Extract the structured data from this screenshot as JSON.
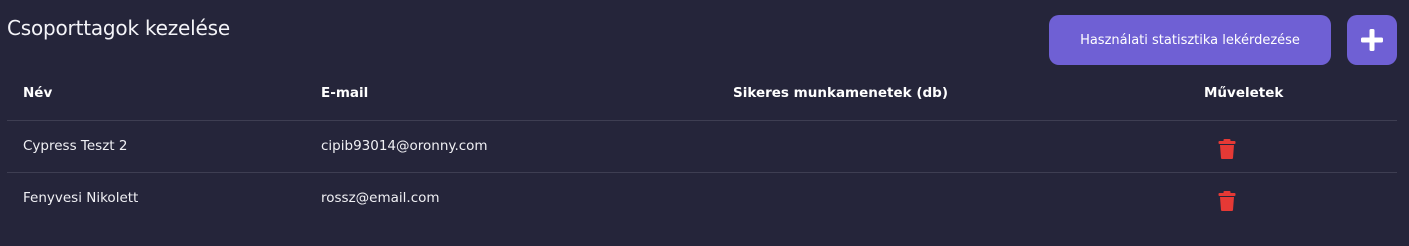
{
  "page": {
    "title": "Csoporttagok kezelése"
  },
  "toolbar": {
    "stats_button_label": "Használati statisztika lekérdezése",
    "add_button_icon": "plus-icon"
  },
  "table": {
    "headers": {
      "name": "Név",
      "email": "E-mail",
      "sessions": "Sikeres munkamenetek (db)",
      "actions": "Műveletek"
    },
    "rows": [
      {
        "name": "Cypress Teszt 2",
        "email": "cipib93014@oronny.com",
        "sessions": "",
        "action_icon": "trash-icon"
      },
      {
        "name": "Fenyvesi Nikolett",
        "email": "rossz@email.com",
        "sessions": "",
        "action_icon": "trash-icon"
      }
    ]
  },
  "colors": {
    "background": "#25253a",
    "accent": "#6f60d4",
    "danger": "#e53935",
    "divider": "#3e3e52"
  }
}
